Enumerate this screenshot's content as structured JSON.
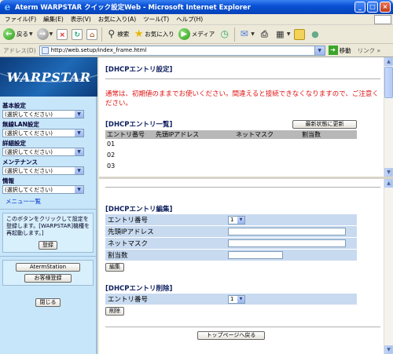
{
  "window": {
    "title": "Aterm WARPSTAR クイック設定Web - Microsoft Internet Explorer",
    "controls": [
      "_",
      "□",
      "×"
    ]
  },
  "menubar": [
    "ファイル(F)",
    "編集(E)",
    "表示(V)",
    "お気に入り(A)",
    "ツール(T)",
    "ヘルプ(H)"
  ],
  "toolbar": {
    "back": "戻る",
    "search": "検索",
    "favorites": "お気に入り",
    "media": "メディア"
  },
  "address": {
    "label": "アドレス(D)",
    "url": "http://web.setup/index_frame.html",
    "go": "移動",
    "links": "リンク"
  },
  "sidebar": {
    "logo": "WARPSTAR",
    "sections": [
      {
        "label": "基本設定",
        "value": "(選択してください)"
      },
      {
        "label": "無線LAN設定",
        "value": "(選択してください)"
      },
      {
        "label": "詳細設定",
        "value": "(選択してください)"
      },
      {
        "label": "メンテナンス",
        "value": "(選択してください)"
      },
      {
        "label": "情報",
        "value": "(選択してください)"
      }
    ],
    "menu_link": "メニュー一覧",
    "note": "このボタンをクリックして設定を登録します。[WARPSTAR]機種を再起動します。]",
    "register": "登録",
    "aterm_station": "AtermStation",
    "customer_register": "お客様登録",
    "close": "閉じる"
  },
  "top_frame": {
    "heading": "[DHCPエントリ設定]",
    "warning": "通常は、初期値のままでお使いください。間違えると接続できなくなりますので、ご注意ください。",
    "list_heading": "[DHCPエントリ一覧]",
    "refresh": "最新状態に更新",
    "columns": [
      "エントリ番号",
      "先頭IPアドレス",
      "ネットマスク",
      "割当数"
    ],
    "rows": [
      "01",
      "02",
      "03"
    ]
  },
  "bottom_frame": {
    "edit_heading": "[DHCPエントリ編集]",
    "edit_fields": [
      {
        "label": "エントリ番号",
        "type": "select",
        "value": "1"
      },
      {
        "label": "先頭IPアドレス",
        "type": "text",
        "value": ""
      },
      {
        "label": "ネットマスク",
        "type": "text",
        "value": ""
      },
      {
        "label": "割当数",
        "type": "text-short",
        "value": ""
      }
    ],
    "edit_button": "編集",
    "delete_heading": "[DHCPエントリ削除]",
    "delete_field": {
      "label": "エントリ番号",
      "value": "1"
    },
    "delete_button": "削除",
    "top_button": "トップページへ戻る"
  }
}
